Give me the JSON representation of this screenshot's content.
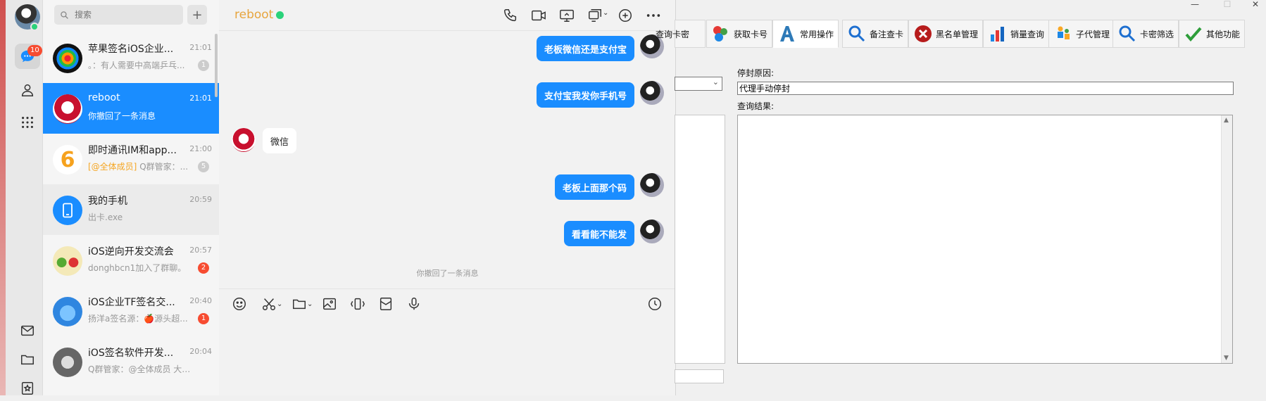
{
  "nav": {
    "chat_badge": "10"
  },
  "search": {
    "placeholder": "搜索"
  },
  "conversations": [
    {
      "name": "苹果签名iOS企业...",
      "time": "21:01",
      "preview": "。：有人需要中高端乒乓...",
      "count": "1"
    },
    {
      "name": "reboot",
      "time": "21:01",
      "preview": "你撤回了一条消息"
    },
    {
      "name": "即时通讯IM和app...",
      "time": "21:00",
      "mention": "[@全体成员]",
      "preview": "Q群管家：...",
      "count": "5"
    },
    {
      "name": "我的手机",
      "time": "20:59",
      "preview": "出卡.exe"
    },
    {
      "name": "iOS逆向开发交流会",
      "time": "20:57",
      "preview": "donghbcn1加入了群聊。",
      "count": "2"
    },
    {
      "name": "iOS企业TF签名交...",
      "time": "20:40",
      "preview": "扬洋a签名源：🍎源头超...",
      "count": "1"
    },
    {
      "name": "iOS签名软件开发...",
      "time": "20:04",
      "preview": "Q群管家：@全体成员 大家..."
    }
  ],
  "chat": {
    "title": "reboot",
    "messages": [
      {
        "side": "right",
        "text": "老板微信还是支付宝"
      },
      {
        "side": "right",
        "text": "支付宝我发你手机号"
      },
      {
        "side": "left",
        "text": "微信"
      },
      {
        "side": "right",
        "text": "老板上面那个码"
      },
      {
        "side": "right",
        "text": "看看能不能发"
      }
    ],
    "recall_notice": "你撤回了一条消息"
  },
  "app": {
    "tabs": [
      {
        "label": "查询卡密",
        "icon": "query-card-icon"
      },
      {
        "label": "获取卡号",
        "icon": "colored-balls-icon"
      },
      {
        "label": "常用操作",
        "icon": "letter-a-icon"
      },
      {
        "label": "备注查卡",
        "icon": "magnifier-icon"
      },
      {
        "label": "黑名单管理",
        "icon": "red-x-icon"
      },
      {
        "label": "销量查询",
        "icon": "bar-chart-icon"
      },
      {
        "label": "子代管理",
        "icon": "people-icon"
      },
      {
        "label": "卡密筛选",
        "icon": "magnifier-icon"
      },
      {
        "label": "其他功能",
        "icon": "green-check-icon"
      }
    ],
    "ban_reason_label": "停封原因:",
    "ban_reason_value": "代理手动停封",
    "query_result_label": "查询结果:",
    "query_result_value": ""
  },
  "colors": {
    "accent": "#1a8dff",
    "title_color": "#e7a53e",
    "online": "#2ad27a",
    "badge_red": "#f74c31"
  }
}
